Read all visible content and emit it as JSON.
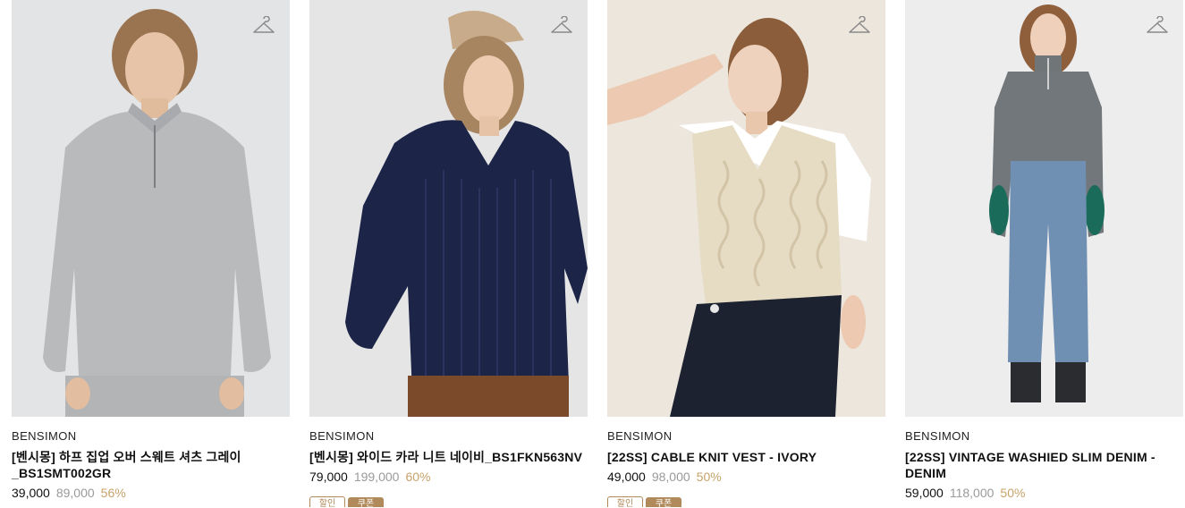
{
  "products": [
    {
      "brand": "BENSIMON",
      "name": "[벤시몽] 하프 집업 오버 스웨트 셔츠 그레이_BS1SMT002GR",
      "price": "39,000",
      "original_price": "89,000",
      "discount": "56%",
      "badges": [],
      "photo": {
        "bg": "#e4e5e6",
        "garment": "#b7b9bb",
        "desc": "grey half-zip sweatshirt"
      }
    },
    {
      "brand": "BENSIMON",
      "name": "[벤시몽] 와이드 카라 니트 네이비_BS1FKN563NV",
      "price": "79,000",
      "original_price": "199,000",
      "discount": "60%",
      "badges": [
        "할인",
        "쿠폰"
      ],
      "photo": {
        "bg": "#e6e6e6",
        "garment": "#1c2447",
        "desc": "navy wide collar knit"
      }
    },
    {
      "brand": "BENSIMON",
      "name": "[22SS] CABLE KNIT VEST - IVORY",
      "price": "49,000",
      "original_price": "98,000",
      "discount": "50%",
      "badges": [
        "할인",
        "쿠폰"
      ],
      "photo": {
        "bg": "#ece7df",
        "garment": "#e6dcc3",
        "desc": "ivory cable knit vest"
      }
    },
    {
      "brand": "BENSIMON",
      "name": "[22SS] VINTAGE WASHIED SLIM DENIM - DENIM",
      "price": "59,000",
      "original_price": "118,000",
      "discount": "50%",
      "badges": [],
      "photo": {
        "bg": "#ececec",
        "garment": "#6f8fb3",
        "desc": "vintage washed slim denim"
      }
    }
  ],
  "icons": {
    "wishlist": "hanger-icon"
  },
  "colors": {
    "discount": "#c8a26a",
    "original_price": "#9a9a9a",
    "badge": "#b08a5a"
  }
}
